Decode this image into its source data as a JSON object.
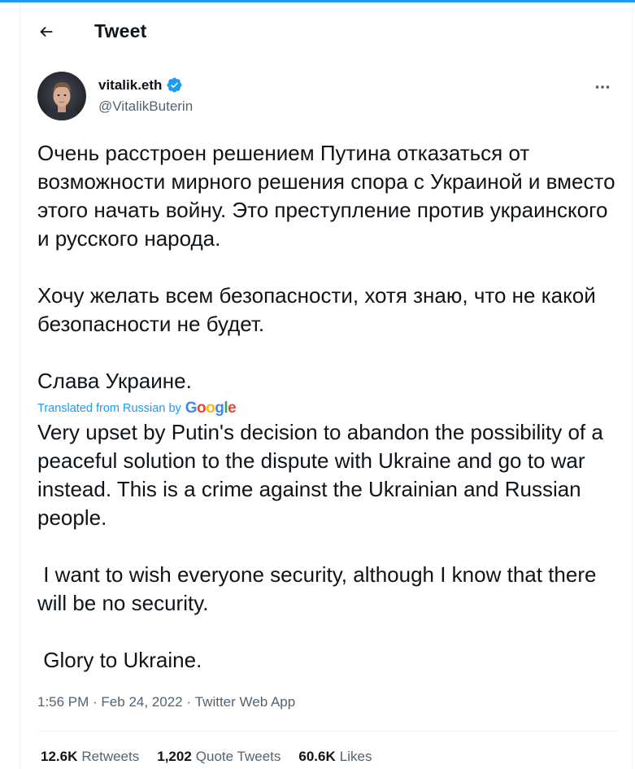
{
  "header": {
    "title": "Tweet",
    "back_icon": "arrow-left-icon"
  },
  "author": {
    "name": "vitalik.eth",
    "handle": "@VitalikButerin",
    "verified": true,
    "verified_color": "#1d9bf0"
  },
  "tweet": {
    "original_paragraphs": [
      "Очень расстроен решением Путина отказаться от возможности мирного решения спора с Украиной и вместо этого начать войну. Это преступление против украинского и русского народа.",
      "Хочу желать всем безопасности, хотя знаю, что не какой безопасности не будет.",
      "Слава Украине."
    ],
    "translated_label": "Translated from Russian by",
    "translator": "Google",
    "translation_paragraphs": [
      "Very upset by Putin's decision to abandon the possibility of a peaceful solution to the dispute with Ukraine and go to war instead. This is a crime against the Ukrainian and Russian people.",
      " I want to wish everyone security, although I know that there will be no security.",
      " Glory to Ukraine."
    ]
  },
  "meta": {
    "time": "1:56 PM",
    "separator": " · ",
    "date": "Feb 24, 2022",
    "source": "Twitter Web App"
  },
  "stats": {
    "retweets_count": "12.6K",
    "retweets_label": "Retweets",
    "quote_tweets_count": "1,202",
    "quote_tweets_label": "Quote Tweets",
    "likes_count": "60.6K",
    "likes_label": "Likes"
  },
  "colors": {
    "accent": "#1d9bf0",
    "text_primary": "#0f1419",
    "text_secondary": "#536471",
    "border": "#eff3f4"
  }
}
